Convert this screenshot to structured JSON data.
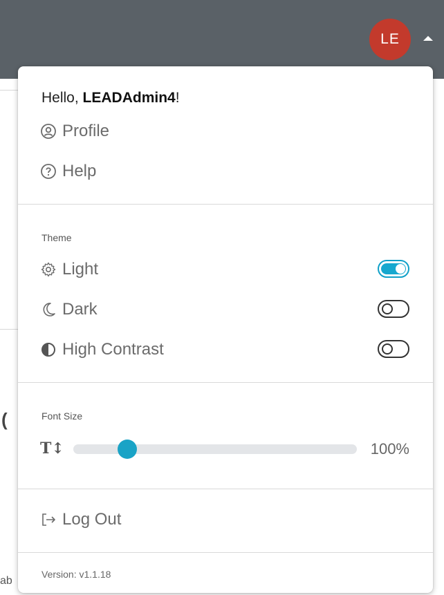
{
  "user": {
    "avatar_initials": "LE",
    "greeting_prefix": "Hello, ",
    "username": "LEADAdmin4",
    "greeting_suffix": "!"
  },
  "menu": {
    "profile_label": "Profile",
    "help_label": "Help",
    "logout_label": "Log Out",
    "version": "Version: v1.1.18"
  },
  "theme": {
    "label": "Theme",
    "options": [
      {
        "label": "Light",
        "icon": "gear-icon",
        "enabled": true
      },
      {
        "label": "Dark",
        "icon": "moon-icon",
        "enabled": false
      },
      {
        "label": "High Contrast",
        "icon": "contrast-icon",
        "enabled": false
      }
    ]
  },
  "font_size": {
    "label": "Font Size",
    "value_text": "100%",
    "slider_fraction": 0.18
  },
  "colors": {
    "topbar": "#5a6167",
    "avatar": "#c33a2c",
    "accent": "#17a8cf"
  }
}
